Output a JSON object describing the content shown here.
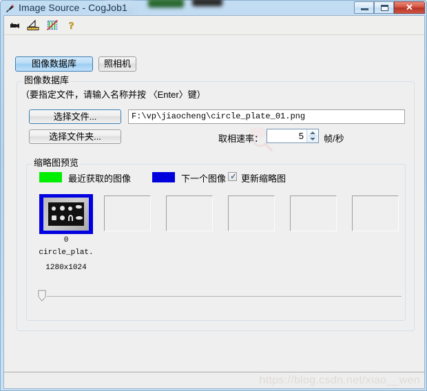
{
  "window": {
    "title": "Image Source - CogJob1",
    "title_icon": "image-source-icon",
    "controls": {
      "minimize": "minimize-button",
      "maximize": "maximize-button",
      "close_label": "✕"
    }
  },
  "toolbar": {
    "items": [
      {
        "name": "camera-icon",
        "tooltip": "Acquire image"
      },
      {
        "name": "calibration-ruler-icon",
        "tooltip": "Calibration"
      },
      {
        "name": "region-disabled-icon",
        "tooltip": "Region off"
      },
      {
        "name": "help-icon",
        "tooltip": "Help"
      }
    ]
  },
  "tabs": [
    {
      "label": "图像数据库",
      "selected": true
    },
    {
      "label": "照相机",
      "selected": false
    }
  ],
  "group_db": {
    "title": "图像数据库",
    "hint": "（要指定文件，请输入名称并按 〈Enter〉键）",
    "select_file_label": "选择文件...",
    "select_folder_label": "选择文件夹...",
    "path_value": "F:\\vp\\jiaocheng\\circle_plate_01.png",
    "path_placeholder": "",
    "rate_label": "取相速率：",
    "rate_value": "5",
    "rate_unit": "帧/秒"
  },
  "group_thumbs": {
    "title": "缩略图预览",
    "legend": [
      {
        "name": "recent-swatch",
        "color": "#00ee00",
        "label": "最近获取的图像"
      },
      {
        "name": "next-swatch",
        "color": "#0000dd",
        "label": "下一个图像"
      }
    ],
    "update_checkbox": {
      "label": "更新缩略图",
      "checked": true,
      "mark": "✓"
    },
    "selected_thumb": {
      "index": "0",
      "name": "circle_plat.",
      "size": "1280x1024",
      "highlight_color": "#0000e0"
    },
    "empty_slots": 5,
    "scroll_position": "0"
  },
  "statusbar": {
    "watermark": "https://blog.csdn.net/xiao__wen"
  }
}
